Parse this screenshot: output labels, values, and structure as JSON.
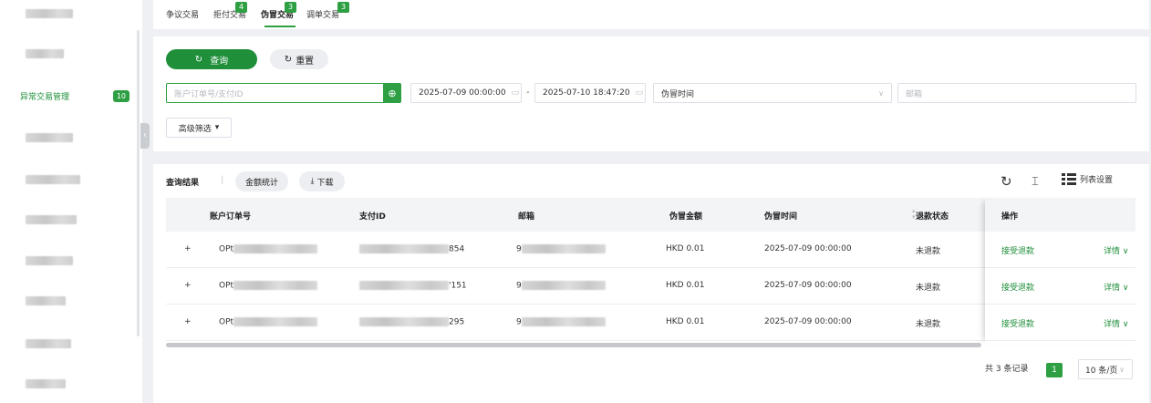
{
  "sidebar": {
    "active_item": {
      "label": "异常交易管理",
      "badge": "10"
    }
  },
  "tabs": [
    {
      "label": "争议交易"
    },
    {
      "label": "拒付交易",
      "badge": "4"
    },
    {
      "label": "伪冒交易",
      "badge": "3"
    },
    {
      "label": "调单交易",
      "badge": "3"
    }
  ],
  "search": {
    "query_label": "查询",
    "reset_label": "重置",
    "order_placeholder": "账户订单号/支付ID",
    "start_time": "2025-07-09 00:00:00",
    "range_sep": "-",
    "end_time": "2025-07-10 18:47:20",
    "time_type": "伪冒时间",
    "email_placeholder": "邮箱",
    "advanced_label": "高级筛选"
  },
  "results": {
    "title": "查询结果",
    "amount_stats_label": "金额统计",
    "download_label": "下载",
    "list_settings_label": "列表设置",
    "columns": [
      "账户订单号",
      "支付ID",
      "邮箱",
      "伪冒金额",
      "伪冒时间",
      "退款状态",
      "操作"
    ],
    "rows": [
      {
        "expand": "+",
        "order_prefix": "OPt",
        "pay_suffix": "854",
        "email_prefix": "9",
        "amount": "HKD 0.01",
        "time": "2025-07-09 00:00:00",
        "refund_status": "未退款",
        "action": "接受退款",
        "detail": "详情"
      },
      {
        "expand": "+",
        "order_prefix": "OPt",
        "pay_suffix": "'151",
        "email_prefix": "9",
        "amount": "HKD 0.01",
        "time": "2025-07-09 00:00:00",
        "refund_status": "未退款",
        "action": "接受退款",
        "detail": "详情"
      },
      {
        "expand": "+",
        "order_prefix": "OPt",
        "pay_suffix": "295",
        "email_prefix": "9",
        "amount": "HKD 0.01",
        "time": "2025-07-09 00:00:00",
        "refund_status": "未退款",
        "action": "接受退款",
        "detail": "详情"
      }
    ],
    "total_text": "共 3 条记录",
    "current_page": "1",
    "page_size": "10 条/页"
  },
  "colors": {
    "accent": "#2ea043",
    "accent_dark": "#1f8f3a"
  },
  "icons": [
    "refresh-icon",
    "calendar-icon",
    "plus-circle-icon",
    "download-icon",
    "column-height-icon",
    "list-settings-icon",
    "chevron-down-icon",
    "collapse-arrow-icon"
  ]
}
